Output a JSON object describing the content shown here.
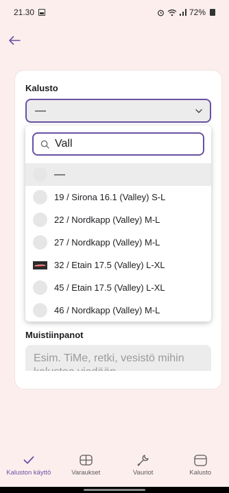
{
  "status_bar": {
    "time": "21.30",
    "battery": "72%"
  },
  "form": {
    "equipment_label": "Kalusto",
    "equipment_value": "—",
    "search_value": "Vall",
    "notes_label": "Muistiinpanot",
    "notes_placeholder": "Esim. TiMe, retki, vesistö mihin kalustoa viedään"
  },
  "dropdown_options": [
    {
      "label": "—",
      "selected": true
    },
    {
      "label": "19 / Sirona 16.1 (Valley) S-L",
      "selected": false
    },
    {
      "label": "22 / Nordkapp (Valley) M-L",
      "selected": false
    },
    {
      "label": "27 / Nordkapp (Valley) M-L",
      "selected": false
    },
    {
      "label": "32 / Etain 17.5 (Valley) L-XL",
      "selected": false,
      "has_thumbnail": true
    },
    {
      "label": "45 / Etain 17.5 (Valley) L-XL",
      "selected": false
    },
    {
      "label": "46 / Nordkapp (Valley) M-L",
      "selected": false
    }
  ],
  "bottom_nav": [
    {
      "label": "Kaluston käyttö",
      "icon": "check-icon",
      "active": true
    },
    {
      "label": "Varaukset",
      "icon": "calendar-grid-icon",
      "active": false
    },
    {
      "label": "Vauriot",
      "icon": "wrench-icon",
      "active": false
    },
    {
      "label": "Kalusto",
      "icon": "kayak-icon",
      "active": false
    }
  ],
  "colors": {
    "accent": "#6750a4",
    "background": "#fdeeee",
    "field": "#ececec"
  }
}
